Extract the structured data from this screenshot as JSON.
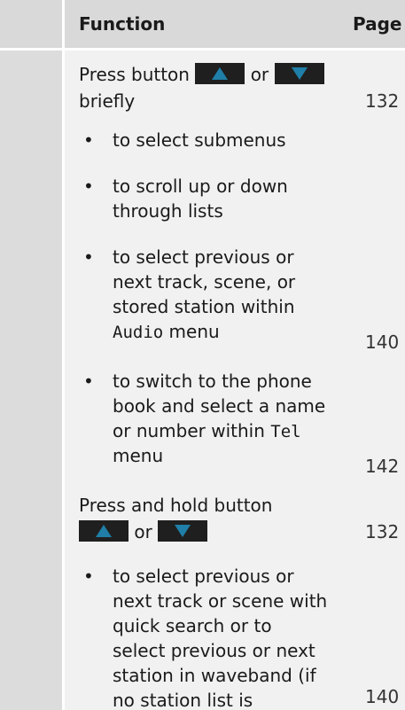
{
  "header": {
    "function_label": "Function",
    "page_label": "Page"
  },
  "rows": {
    "press_brief": {
      "line1_prefix": "Press button",
      "or": "or",
      "line2": "briefly",
      "page": "132"
    },
    "b1": {
      "line1": "to select submenus"
    },
    "b2": {
      "line1": "to scroll up or down",
      "line2": "through lists"
    },
    "b3": {
      "line1": "to select previous or",
      "line2": "next track, scene, or",
      "line3": "stored station within",
      "line4_mono": "Audio",
      "line4_rest": " menu",
      "page": "140"
    },
    "b4": {
      "line1": "to switch to the phone",
      "line2": "book and select a name",
      "line3_prefix": "or number within ",
      "line3_mono": "Tel",
      "line4": "menu",
      "page": "142"
    },
    "press_hold": {
      "line1": "Press and hold button",
      "or": "or",
      "page": "132"
    },
    "b5": {
      "line1": "to select previous or",
      "line2": "next track or scene with",
      "line3": "quick search or to",
      "line4": "select previous or next",
      "line5": "station in waveband (if",
      "line6": "no station list is",
      "page": "140"
    }
  },
  "bullet_char": "•",
  "icons": {
    "up": "up-triangle-icon",
    "down": "down-triangle-icon"
  },
  "colors": {
    "header_bg": "#d9d9d9",
    "content_bg": "#f1f1f1",
    "button_bg": "#1f1f1f",
    "triangle": "#1f7fa8"
  }
}
